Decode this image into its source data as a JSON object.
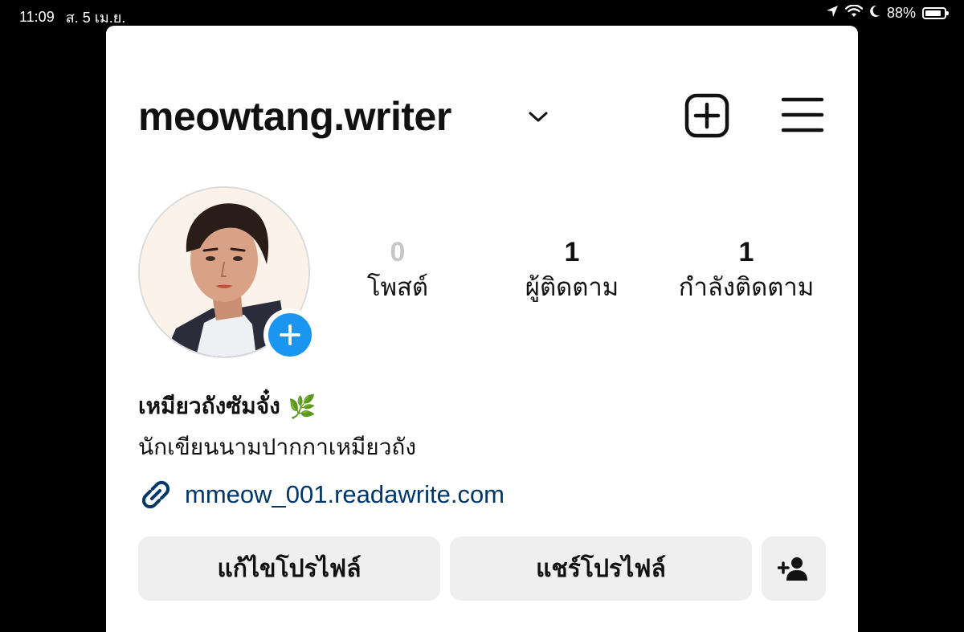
{
  "status_bar": {
    "time": "11:09",
    "date": "ส. 5 เม.ย.",
    "battery": "88%",
    "battery_level": 0.88,
    "icons": [
      "location-arrow-icon",
      "wifi-icon",
      "moon-icon",
      "battery-icon"
    ]
  },
  "profile": {
    "username": "meowtang.writer",
    "display_name": "เหมียวถังซัมจั๋ง",
    "name_emoji": "🌿",
    "bio": "นักเขียนนามปากกาเหมียวถัง",
    "link": "mmeow_001.readawrite.com"
  },
  "stats": [
    {
      "value": "0",
      "label": "โพสต์"
    },
    {
      "value": "1",
      "label": "ผู้ติดตาม"
    },
    {
      "value": "1",
      "label": "กำลังติดตาม"
    }
  ],
  "buttons": {
    "edit_profile": "แก้ไขโปรไฟล์",
    "share_profile": "แชร์โปรไฟล์"
  },
  "colors": {
    "accent_blue": "#1a95f0",
    "link_color": "#00376b",
    "button_bg": "#efefef"
  }
}
